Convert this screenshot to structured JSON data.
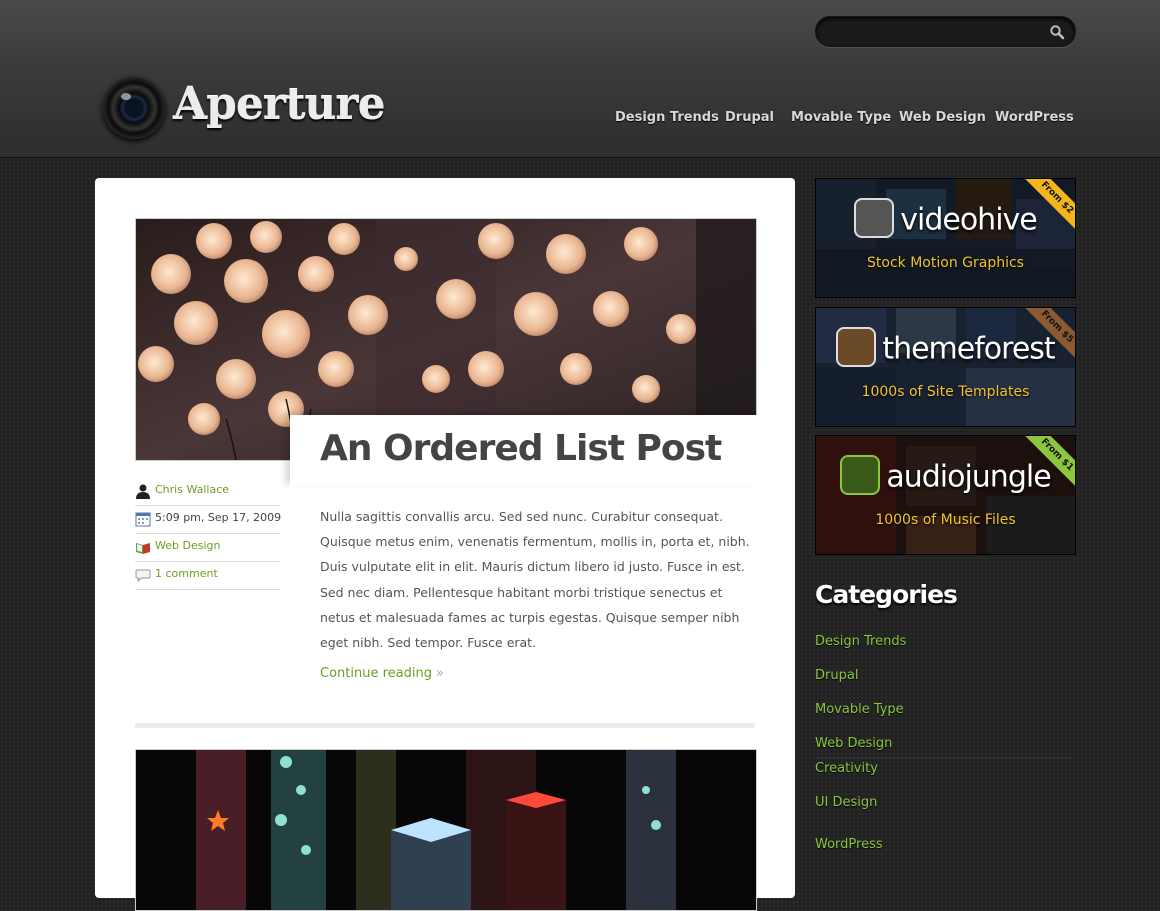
{
  "header": {
    "logo_text": "Aperture",
    "search": {
      "value": "",
      "placeholder": ""
    },
    "nav": [
      "Design Trends",
      "Drupal",
      "Movable Type",
      "Web Design",
      "WordPress"
    ]
  },
  "post1": {
    "title": "An Ordered List Post",
    "author": "Chris Wallace",
    "date": "5:09 pm, Sep 17, 2009",
    "category": "Web Design",
    "comments": "1 comment",
    "excerpt": "Nulla sagittis convallis arcu. Sed sed nunc. Curabitur consequat. Quisque metus enim, venenatis fermentum, mollis in, porta et, nibh. Duis vulputate elit in elit. Mauris dictum libero id justo. Fusce in est. Sed nec diam. Pellentesque habitant morbi tristique senectus et netus et malesuada fames ac turpis egestas. Quisque semper nibh eget nibh. Sed tempor. Fusce erat.",
    "continue": "Continue reading",
    "continue_arrow": "»"
  },
  "ads": [
    {
      "brand": "videohive",
      "tagline": "Stock Motion Graphics",
      "ribbon": "From $2",
      "ribbon_color": "#f2b51c",
      "tagline_color": "#f2c230"
    },
    {
      "brand": "themeforest",
      "tagline": "1000s of Site Templates",
      "ribbon": "From $5",
      "ribbon_color": "#8b5a35",
      "tagline_color": "#f2c230"
    },
    {
      "brand": "audiojungle",
      "tagline": "1000s of Music Files",
      "ribbon": "From $1",
      "ribbon_color": "#8cc63f",
      "tagline_color": "#f2c230"
    }
  ],
  "sidebar": {
    "categories_heading": "Categories",
    "categories": [
      "Design Trends",
      "Drupal",
      "Movable Type",
      "Web Design",
      "Creativity",
      "UI Design",
      "WordPress"
    ]
  },
  "colors": {
    "accent_green": "#6f9e22",
    "sidebar_link": "#8cc63f",
    "title_gray": "#444444"
  },
  "icons": {
    "search": "magnifier-icon",
    "author": "user-icon",
    "date": "calendar-icon",
    "category": "book-icon",
    "comments": "speech-bubble-icon"
  }
}
